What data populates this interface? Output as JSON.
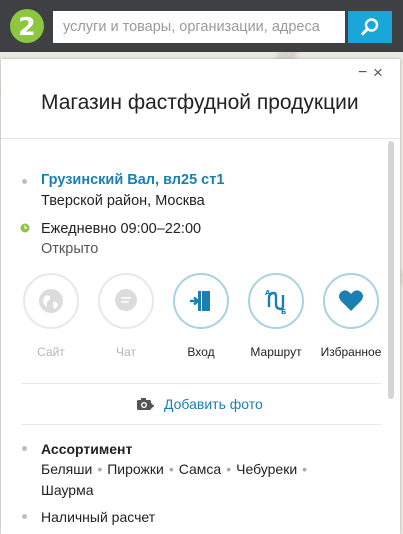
{
  "search": {
    "placeholder": "услуги и товары, организации, адреса",
    "logo_text": "2"
  },
  "card": {
    "title": "Магазин фастфудной продукции",
    "minimize_label": "−",
    "close_label": "×",
    "address": "Грузинский Вал, вл25 ст1",
    "district": "Тверской район, Москва",
    "hours": "Ежедневно 09:00–22:00",
    "status": "Открыто",
    "actions": [
      {
        "label": "Сайт",
        "icon": "globe-icon",
        "enabled": false
      },
      {
        "label": "Чат",
        "icon": "chat-icon",
        "enabled": false
      },
      {
        "label": "Вход",
        "icon": "entrance-icon",
        "enabled": true
      },
      {
        "label": "Маршрут",
        "icon": "route-icon",
        "enabled": true
      },
      {
        "label": "Избранное",
        "icon": "heart-icon",
        "enabled": true
      }
    ],
    "add_photo": "Добавить фото",
    "assortment_title": "Ассортимент",
    "assortment": [
      "Беляши",
      "Пирожки",
      "Самса",
      "Чебуреки",
      "Шаурма"
    ],
    "payment": "Наличный расчет"
  },
  "colors": {
    "topbar": "#3e4044",
    "accent": "#1aa6d8",
    "link": "#1a7fb3",
    "logo": "#8dc63f",
    "open_clock": "#8dc63f"
  }
}
